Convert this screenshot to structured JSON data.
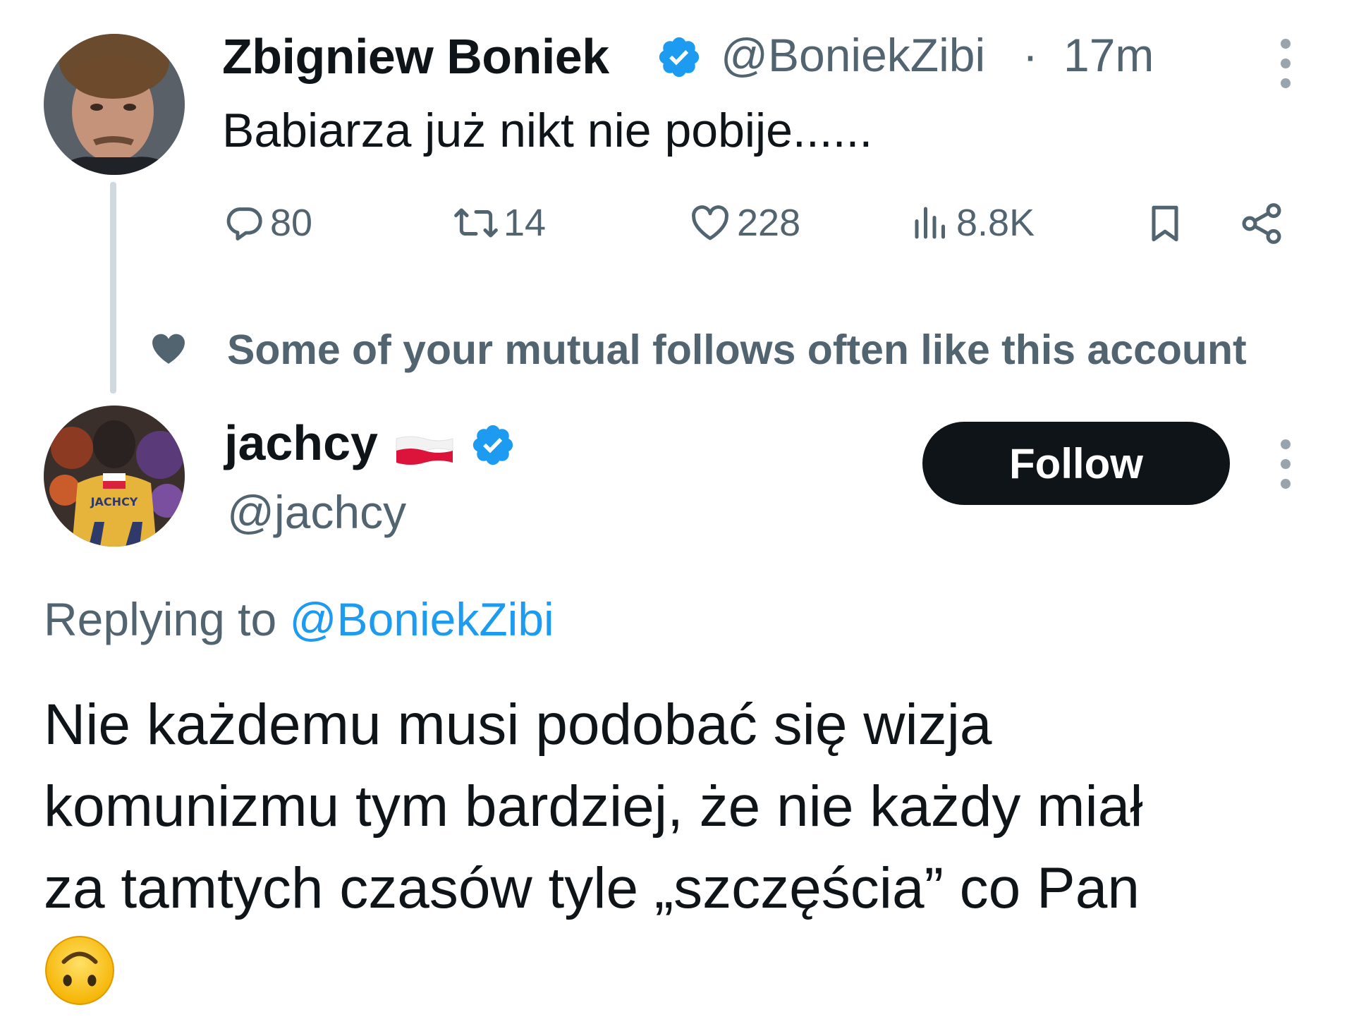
{
  "original_tweet": {
    "author_name": "Zbigniew Boniek",
    "handle": "@BoniekZibi",
    "separator": "·",
    "time": "17m",
    "text": "Babiarza już nikt nie pobije......",
    "stats": {
      "replies": "80",
      "retweets": "14",
      "likes": "228",
      "views": "8.8K"
    },
    "icons": [
      "verified-badge-icon",
      "more-icon",
      "reply-icon",
      "retweet-icon",
      "like-icon",
      "views-icon",
      "bookmark-icon",
      "share-icon"
    ]
  },
  "social_context": {
    "text": "Some of your mutual follows often like this account",
    "icon": "heart-icon"
  },
  "reply_tweet": {
    "author_name": "jachcy",
    "flag": "poland-flag",
    "handle": "@jachcy",
    "follow_label": "Follow",
    "replying_prefix": "Replying to",
    "replying_mention": "@BoniekZibi",
    "text_lines": [
      "Nie każdemu musi podobać się wizja",
      "komunizmu tym bardziej, że nie każdy miał",
      "za tamtych czasów tyle „szczęścia” co Pan"
    ],
    "emoji": "upside-down-face"
  },
  "colors": {
    "text_primary": "#0f1419",
    "text_secondary": "#536471",
    "accent": "#1d9bf0",
    "follow_button": "#0f1419"
  }
}
